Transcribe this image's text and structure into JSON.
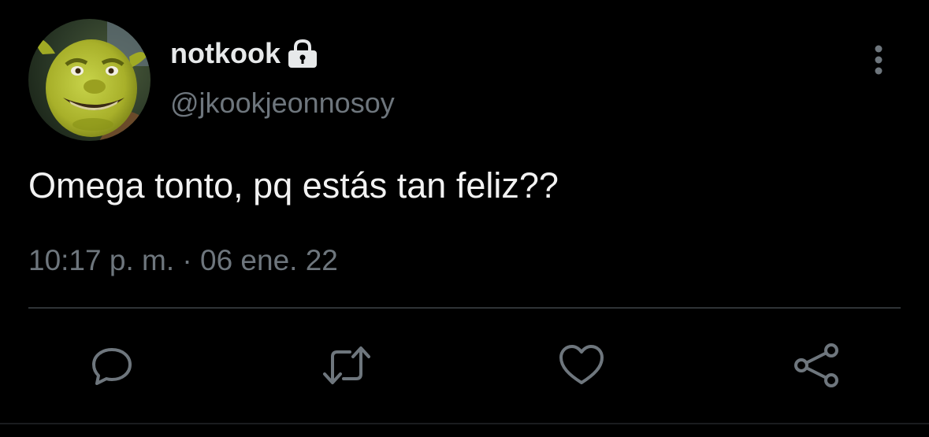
{
  "user": {
    "display_name": "notkook",
    "handle": "@jkookjeonnosoy",
    "protected_icon": "lock-icon",
    "avatar": "shrek-avatar"
  },
  "tweet": {
    "text": "Omega tonto, pq estás tan feliz??",
    "timestamp": "10:17 p. m. · 06 ene. 22"
  },
  "actions": {
    "reply_icon": "reply-icon",
    "retweet_icon": "retweet-icon",
    "like_icon": "heart-icon",
    "share_icon": "share-icon",
    "more_icon": "more-vertical-icon"
  },
  "colors": {
    "background": "#000000",
    "primary_text": "#e7e9ea",
    "secondary_text": "#6e767d",
    "divider": "#2f3336"
  }
}
